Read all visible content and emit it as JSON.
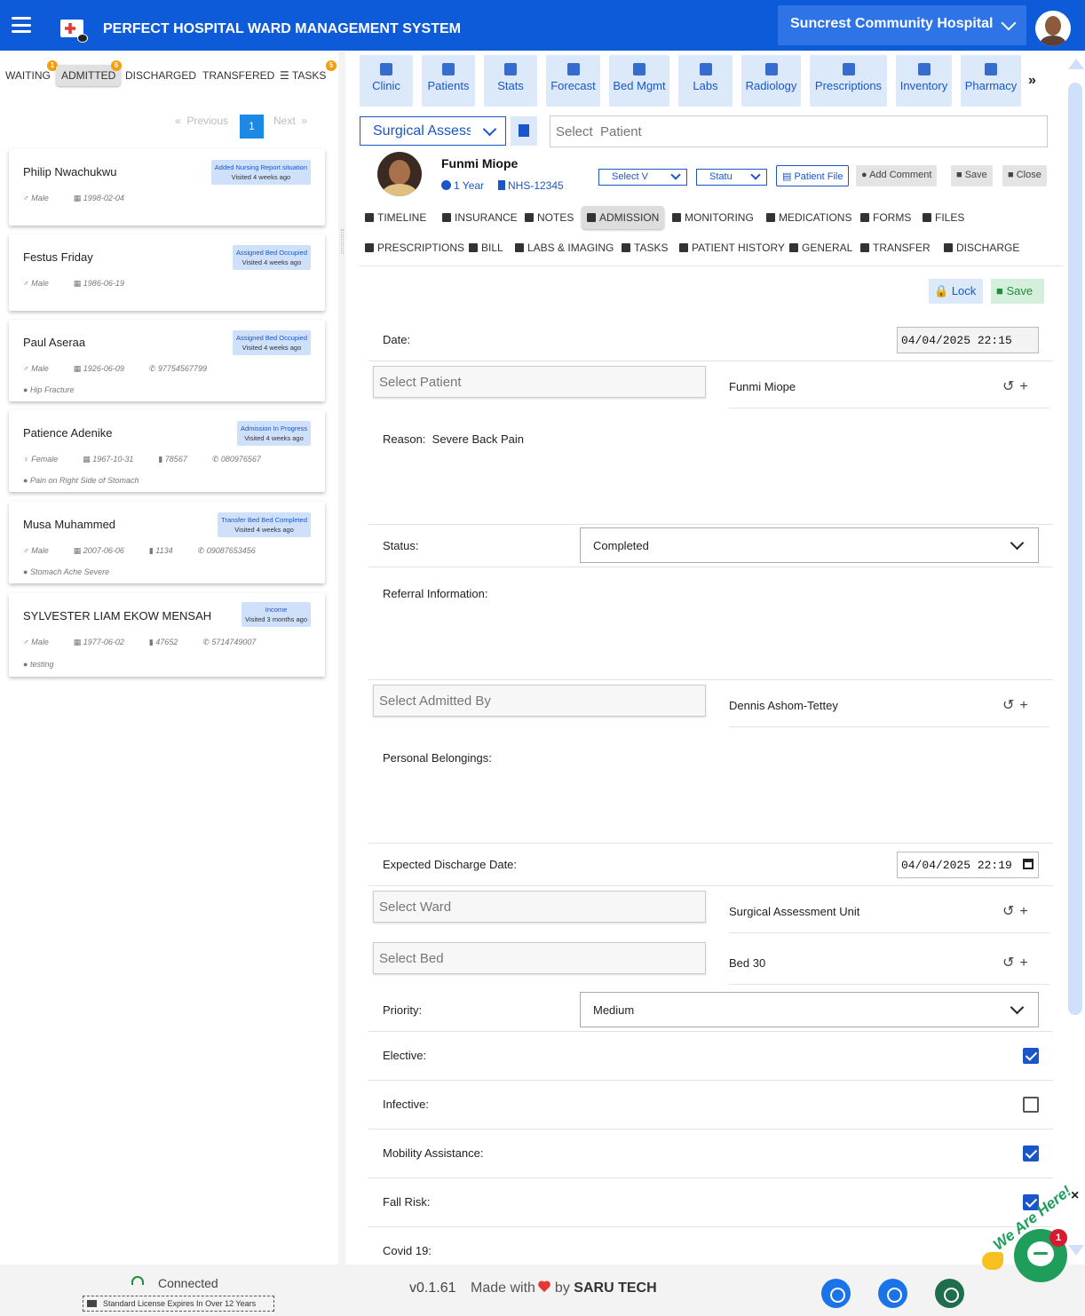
{
  "header": {
    "title": "PERFECT HOSPITAL WARD MANAGEMENT SYSTEM",
    "hospital": "Suncrest Community Hospital",
    "accent": "#0d5bd8"
  },
  "left_tabs": [
    {
      "label": "WAITING",
      "badge": "1"
    },
    {
      "label": "ADMITTED",
      "badge": "6",
      "active": true
    },
    {
      "label": "DISCHARGED"
    },
    {
      "label": "TRANSFERED"
    },
    {
      "label": "TASKS",
      "badge": "5"
    }
  ],
  "pager": {
    "previous": "Previous",
    "page": "1",
    "next": "Next"
  },
  "patients": [
    {
      "name": "Philip Nwachukwu",
      "status": "Added Nursing Report situation",
      "visited": "Visited 4 weeks ago",
      "gender": "Male",
      "dob": "1998-02-04"
    },
    {
      "name": "Festus Friday",
      "status": "Assigned Bed Occupied",
      "visited": "Visited 4 weeks ago",
      "gender": "Male",
      "dob": "1986-06-19"
    },
    {
      "name": "Paul Aseraa",
      "status": "Assigned Bed Occupied",
      "visited": "Visited 4 weeks ago",
      "gender": "Male",
      "dob": "1926-06-09",
      "phone": "97754567799",
      "note": "Hip Fracture"
    },
    {
      "name": "Patience Adenike",
      "status": "Admission In Progress",
      "visited": "Visited 4 weeks ago",
      "gender": "Female",
      "dob": "1967-10-31",
      "id": "78567",
      "phone": "080976567",
      "note": "Pain on Right Side of Stomach"
    },
    {
      "name": "Musa Muhammed",
      "status": "Transfer Bed Bed Completed",
      "visited": "Visited 4 weeks ago",
      "gender": "Male",
      "dob": "2007-06-06",
      "id": "1134",
      "phone": "09087653456",
      "note": "Stomach Ache Severe"
    },
    {
      "name": "SYLVESTER LIAM EKOW MENSAH",
      "status": "Income",
      "visited": "Visited 3 months ago",
      "gender": "Male",
      "dob": "1977-06-02",
      "id": "47652",
      "phone": "5714749007",
      "note": "testing"
    }
  ],
  "nav": [
    "Clinic",
    "Patients",
    "Stats",
    "Forecast",
    "Bed Mgmt",
    "Labs",
    "Radiology",
    "Prescriptions",
    "Inventory",
    "Pharmacy"
  ],
  "nav_more": "»",
  "unit_select": "Surgical Assessment Unit",
  "patient_search_placeholder": "Select  Patient",
  "patient": {
    "name": "Funmi Miope",
    "age": "1 Year",
    "nhs": "NHS-12345",
    "select_v": "Select V",
    "status_mini": "Statu",
    "patient_file": "Patient File",
    "add_comment": "Add Comment",
    "save": "Save",
    "close": "Close"
  },
  "subtabs_row1": [
    "TIMELINE",
    "INSURANCE",
    "NOTES",
    "ADMISSION",
    "MONITORING",
    "MEDICATIONS",
    "FORMS",
    "FILES"
  ],
  "subtabs_row2": [
    "PRESCRIPTIONS",
    "BILL",
    "LABS & IMAGING",
    "TASKS",
    "PATIENT HISTORY",
    "GENERAL",
    "TRANSFER",
    "DISCHARGE"
  ],
  "form": {
    "lock": "Lock",
    "save": "Save",
    "date_label": "Date:",
    "date_value": "04/04/2025 22:15",
    "select_patient": "Select  Patient",
    "patient_value": "Funmi Miope",
    "reason_label": "Reason:",
    "reason_value": "Severe Back Pain",
    "status_label": "Status:",
    "status_value": "Completed",
    "referral_label": "Referral Information:",
    "select_admitted_by": "Select  Admitted By",
    "admitted_by_value": "Dennis Ashom-Tettey",
    "belongings_label": "Personal Belongings:",
    "discharge_label": "Expected Discharge Date:",
    "discharge_value": "04/04/2025 22:19",
    "select_ward": "Select  Ward",
    "ward_value": "Surgical Assessment Unit",
    "select_bed": "Select  Bed",
    "bed_value": "Bed 30",
    "priority_label": "Priority:",
    "priority_value": "Medium",
    "elective_label": "Elective:",
    "elective": true,
    "infective_label": "Infective:",
    "infective": false,
    "mobility_label": "Mobility Assistance:",
    "mobility": true,
    "fall_label": "Fall Risk:",
    "fall": true,
    "covid_label": "Covid 19:"
  },
  "footer": {
    "connected": "Connected",
    "license": "Standard License Expires In Over 12 Years",
    "version": "v0.1.61",
    "made_with": "Made with",
    "by": "by",
    "company": "SARU TECH"
  },
  "chat": {
    "label": "We Are Here!",
    "count": "1",
    "close": "×"
  }
}
